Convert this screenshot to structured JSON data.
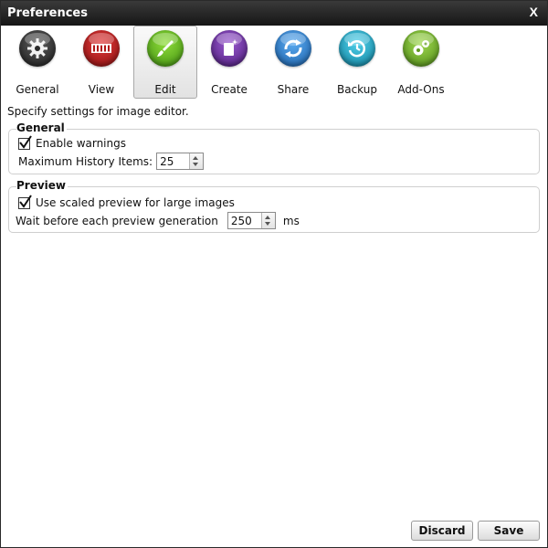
{
  "window": {
    "title": "Preferences",
    "close_label": "X"
  },
  "toolbar": {
    "items": [
      {
        "label": "General",
        "icon": "gear-icon",
        "color": "#3c3c3c",
        "active": false
      },
      {
        "label": "View",
        "icon": "film-strip-icon",
        "color": "#c41b1b",
        "active": false
      },
      {
        "label": "Edit",
        "icon": "paintbrush-icon",
        "color": "#6cbf1f",
        "active": true
      },
      {
        "label": "Create",
        "icon": "new-document-icon",
        "color": "#6b2fa0",
        "active": false
      },
      {
        "label": "Share",
        "icon": "share-arrows-icon",
        "color": "#2a86d8",
        "active": false
      },
      {
        "label": "Backup",
        "icon": "backup-clock-icon",
        "color": "#1aa3c4",
        "active": false
      },
      {
        "label": "Add-Ons",
        "icon": "gears-icon",
        "color": "#74b52a",
        "active": false
      }
    ]
  },
  "intro": "Specify settings for image editor.",
  "general": {
    "title": "General",
    "enable_warnings": {
      "label": "Enable warnings",
      "checked": true
    },
    "max_history": {
      "label": "Maximum History Items:",
      "value": "25"
    }
  },
  "preview": {
    "title": "Preview",
    "scaled_preview": {
      "label": "Use scaled preview for large images",
      "checked": true
    },
    "wait": {
      "label": "Wait before each preview generation",
      "value": "250",
      "unit": "ms"
    }
  },
  "footer": {
    "discard_label": "Discard",
    "save_label": "Save"
  }
}
